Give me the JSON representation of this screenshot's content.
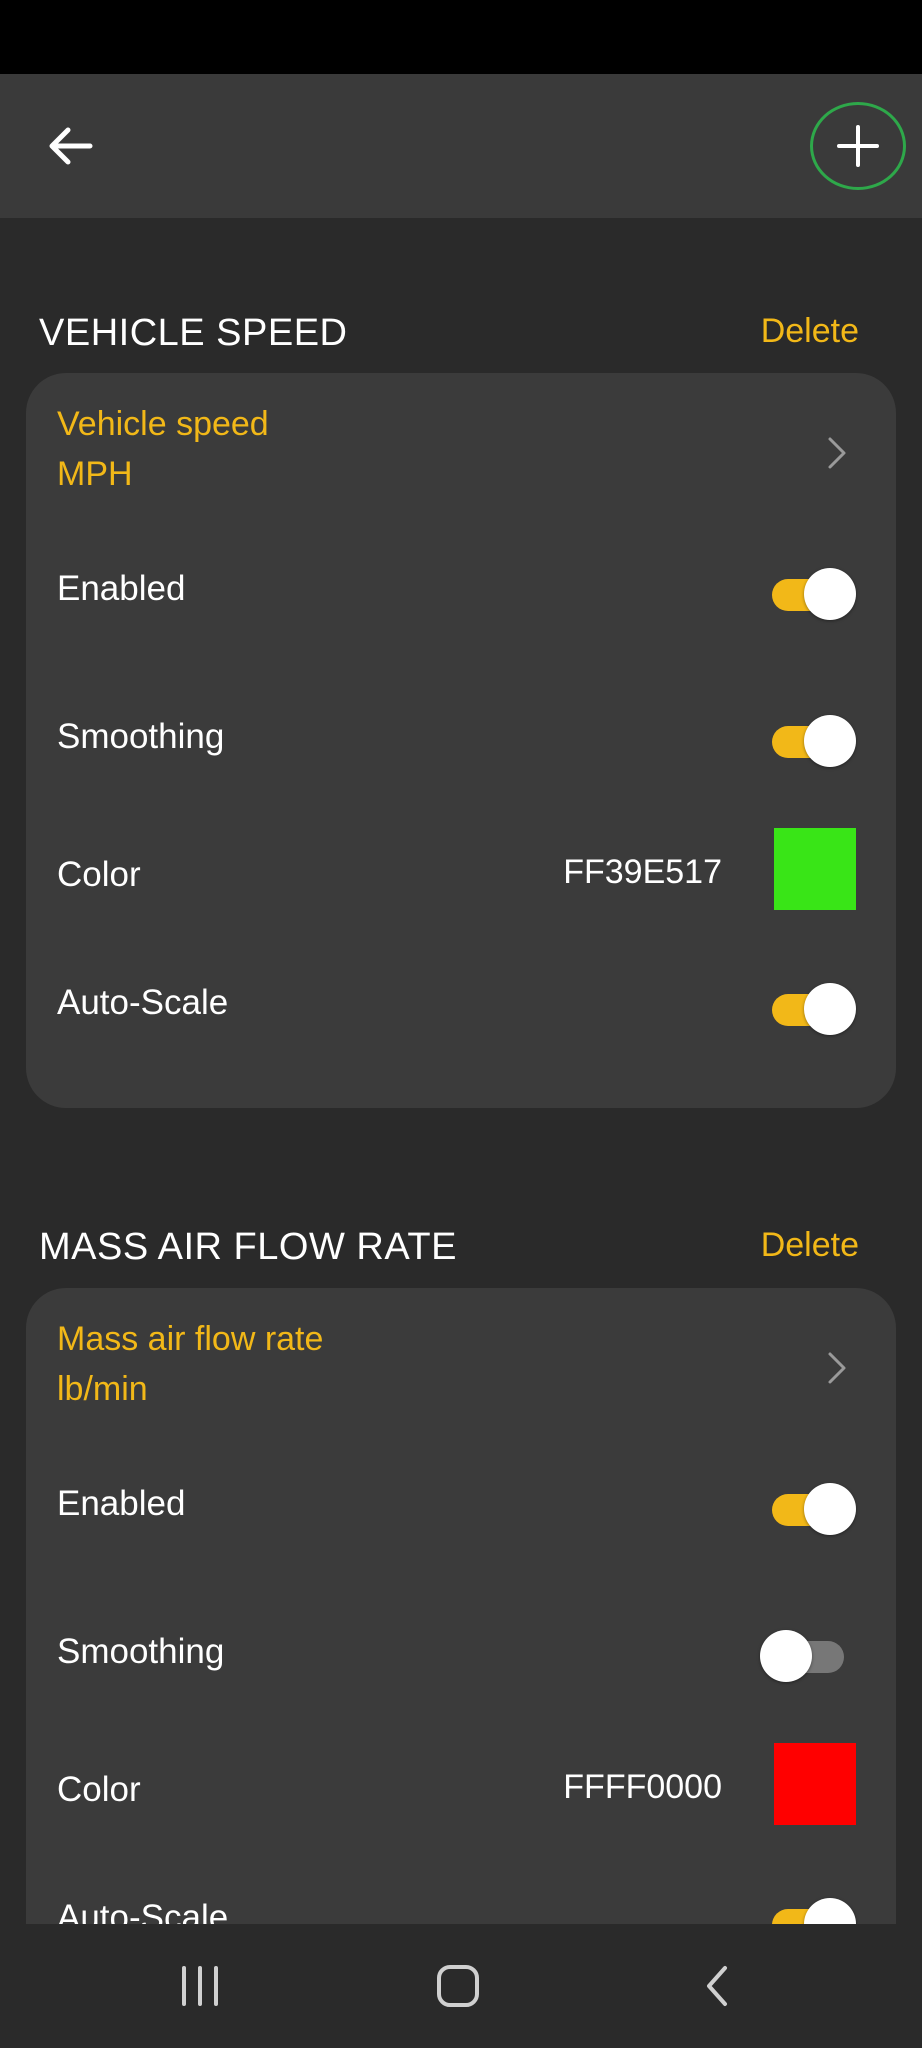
{
  "theme": {
    "accent": "#f2b818",
    "background": "#2a2a2a",
    "card": "#3b3b3b",
    "add_button_ring": "#2ea84a"
  },
  "header": {
    "back_icon": "arrow-left-icon",
    "add_icon": "plus-icon"
  },
  "sections": [
    {
      "title": "VEHICLE SPEED",
      "delete_label": "Delete",
      "source_name": "Vehicle speed",
      "source_unit": "MPH",
      "enabled_label": "Enabled",
      "enabled": true,
      "smoothing_label": "Smoothing",
      "smoothing": true,
      "color_label": "Color",
      "color_hex": "FF39E517",
      "swatch_color": "#39e517",
      "autoscale_label": "Auto-Scale",
      "autoscale": true
    },
    {
      "title": "MASS AIR FLOW RATE",
      "delete_label": "Delete",
      "source_name": "Mass air flow rate",
      "source_unit": "lb/min",
      "enabled_label": "Enabled",
      "enabled": true,
      "smoothing_label": "Smoothing",
      "smoothing": false,
      "color_label": "Color",
      "color_hex": "FFFF0000",
      "swatch_color": "#ff0000",
      "autoscale_label": "Auto-Scale",
      "autoscale": true
    }
  ],
  "nav": {
    "recents_icon": "recent-apps-icon",
    "home_icon": "home-icon",
    "back_icon": "back-chevron-icon"
  }
}
